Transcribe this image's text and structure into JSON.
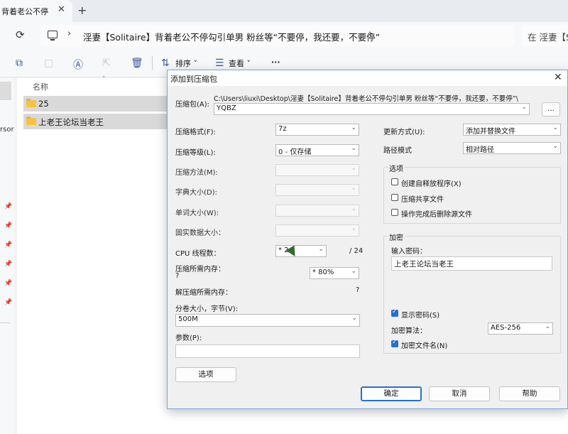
{
  "tab": {
    "title": "背着老公不停",
    "close": "✕",
    "new": "+"
  },
  "address": {
    "refresh": "⟳",
    "sep": "›",
    "breadcrumb": "淫妻【Solitaire】背着老公不停勾引单男 粉丝等“不要停，我还要，不要停”",
    "search_placeholder": "在 淫妻【S"
  },
  "toolbar": {
    "sort": "排序",
    "view": "查看",
    "more": "···"
  },
  "sidebar": {
    "partial_text": "rsor"
  },
  "files": {
    "column_name": "名称",
    "rows": [
      {
        "label": "25"
      },
      {
        "label": "上老王论坛当老王"
      }
    ]
  },
  "dialog": {
    "title": "添加到压缩包",
    "archive_label": "压缩包(A):",
    "archive_path": "C:\\Users\\liuxi\\Desktop\\淫妻【Solitaire】背着老公不停勾引单男 粉丝等“不要停，我还要，不要停”\\",
    "archive_name": "YQBZ",
    "browse": "...",
    "format_label": "压缩格式(F):",
    "format_value": "7z",
    "level_label": "压缩等级(L):",
    "level_value": "0 - 仅存储",
    "method_label": "压缩方法(M):",
    "dict_label": "字典大小(D):",
    "word_label": "单词大小(W):",
    "solid_label": "固实数据大小：",
    "cpu_label": "CPU 线程数：",
    "cpu_value": "* 24",
    "cpu_total": "/ 24",
    "mem_comp_label": "压缩所需内存：",
    "mem_comp_q": "?",
    "mem_comp_value": "* 80%",
    "mem_decomp_label": "解压缩所需内存：",
    "mem_decomp_q": "?",
    "split_label": "分卷大小，字节(V):",
    "split_value": "500M",
    "params_label": "参数(P):",
    "options_button": "选项",
    "update_label": "更新方式(U):",
    "update_value": "添加并替换文件",
    "path_label": "路径模式",
    "path_value": "相对路径",
    "options_group": "选项",
    "opt_sfx": "创建自释放程序(X)",
    "opt_shared": "压缩共享文件",
    "opt_delete": "操作完成后删除源文件",
    "encrypt_group": "加密",
    "password_label": "输入密码：",
    "password_value": "上老王论坛当老王",
    "show_password": "显示密码(S)",
    "enc_method_label": "加密算法：",
    "enc_method_value": "AES-256",
    "encrypt_names": "加密文件名(N)",
    "ok": "确定",
    "cancel": "取消",
    "help": "帮助"
  }
}
